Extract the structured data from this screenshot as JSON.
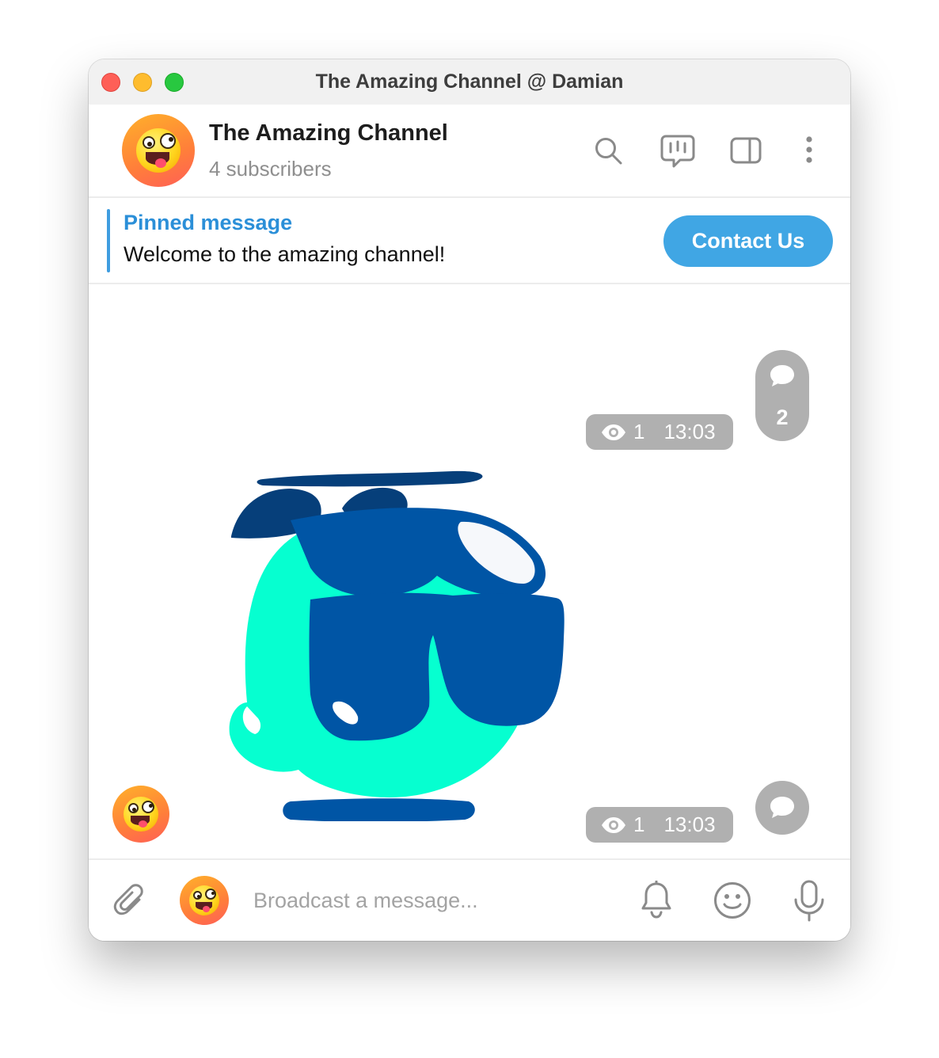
{
  "window": {
    "title": "The Amazing Channel @ Damian"
  },
  "header": {
    "channel_name": "The Amazing Channel",
    "subscribers": "4 subscribers",
    "icons": [
      "search-icon",
      "live-stream-icon",
      "sidebar-toggle-icon",
      "more-options-icon"
    ]
  },
  "pinned": {
    "title": "Pinned message",
    "text": "Welcome to the amazing channel!",
    "button_label": "Contact Us",
    "accent_color": "#2b8fd8",
    "button_color": "#40a6e4"
  },
  "messages": [
    {
      "views": "1",
      "time": "13:03",
      "comments": "2"
    },
    {
      "type": "sticker",
      "sticker": "propeller-blob-with-sunglasses",
      "views": "1",
      "time": "13:03"
    }
  ],
  "composer": {
    "placeholder": "Broadcast a message...",
    "icons": [
      "attach-icon",
      "bell-icon",
      "emoji-icon",
      "microphone-icon"
    ]
  }
}
